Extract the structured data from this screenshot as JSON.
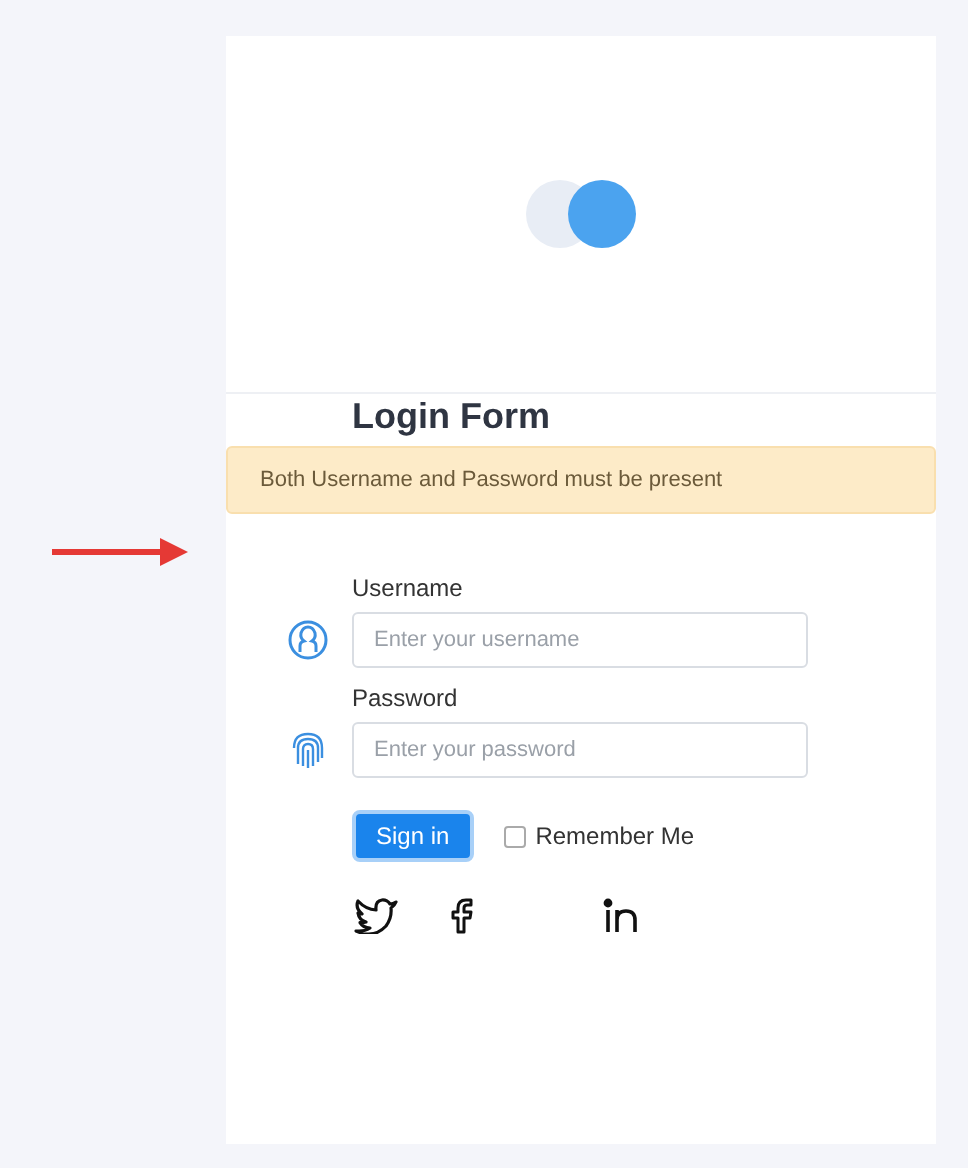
{
  "form": {
    "title": "Login Form"
  },
  "alert": {
    "message": "Both Username and Password must be present"
  },
  "fields": [
    {
      "kind": "user",
      "label": "Username",
      "placeholder": "Enter your username"
    },
    {
      "kind": "fingerprint",
      "label": "Password",
      "placeholder": "Enter your password"
    }
  ],
  "submit": {
    "label": "Sign in"
  },
  "remember": {
    "label": "Remember Me",
    "checked": false
  }
}
